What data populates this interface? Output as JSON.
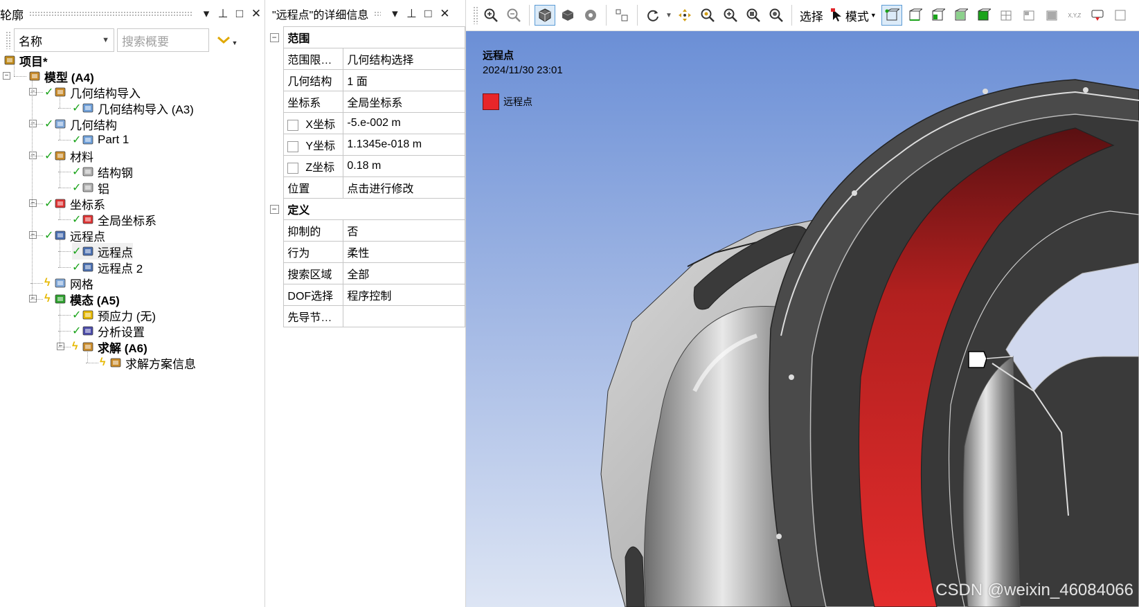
{
  "outline": {
    "title": "轮廓",
    "controls": [
      "▾",
      "⊥",
      "□",
      "✕"
    ],
    "name_select": "名称",
    "search_placeholder": "搜索概要",
    "tree": [
      {
        "label": "项目*",
        "bold": true,
        "status": "none",
        "icon": "project-icon"
      },
      {
        "label": "模型 (A4)",
        "bold": true,
        "status": "none",
        "icon": "model-icon"
      },
      {
        "label": "几何结构导入",
        "bold": false,
        "status": "check",
        "icon": "geometry-import-icon"
      },
      {
        "label": "几何结构导入 (A3)",
        "bold": false,
        "status": "check",
        "icon": "geometry-import-item-icon"
      },
      {
        "label": "几何结构",
        "bold": false,
        "status": "check",
        "icon": "geometry-icon"
      },
      {
        "label": "Part 1",
        "bold": false,
        "status": "check",
        "icon": "part-icon"
      },
      {
        "label": "材料",
        "bold": false,
        "status": "check",
        "icon": "materials-icon"
      },
      {
        "label": "结构钢",
        "bold": false,
        "status": "check",
        "icon": "material-tag-icon"
      },
      {
        "label": "铝",
        "bold": false,
        "status": "check",
        "icon": "material-tag-icon"
      },
      {
        "label": "坐标系",
        "bold": false,
        "status": "check",
        "icon": "coordinate-systems-icon"
      },
      {
        "label": "全局坐标系",
        "bold": false,
        "status": "check",
        "icon": "coordinate-system-icon"
      },
      {
        "label": "远程点",
        "bold": false,
        "status": "check",
        "icon": "remote-points-icon"
      },
      {
        "label": "远程点",
        "bold": false,
        "status": "check",
        "icon": "remote-point-icon"
      },
      {
        "label": "远程点 2",
        "bold": false,
        "status": "check",
        "icon": "remote-point-icon"
      },
      {
        "label": "网格",
        "bold": false,
        "status": "bolt",
        "icon": "mesh-icon"
      },
      {
        "label": "模态 (A5)",
        "bold": true,
        "status": "bolt",
        "icon": "modal-icon"
      },
      {
        "label": "预应力 (无)",
        "bold": false,
        "status": "check",
        "icon": "prestress-icon"
      },
      {
        "label": "分析设置",
        "bold": false,
        "status": "check",
        "icon": "analysis-settings-icon"
      },
      {
        "label": "求解 (A6)",
        "bold": true,
        "status": "bolt",
        "icon": "solution-icon"
      },
      {
        "label": "求解方案信息",
        "bold": false,
        "status": "bolt",
        "icon": "solution-info-icon"
      }
    ]
  },
  "details": {
    "title": "\"远程点\"的详细信息",
    "controls": [
      "▾",
      "⊥",
      "□",
      "✕"
    ],
    "groups": [
      {
        "name": "范围",
        "rows": [
          {
            "key": "范围限定...",
            "value": "几何结构选择",
            "checkbox": false
          },
          {
            "key": "几何结构",
            "value": "1 面",
            "checkbox": false
          },
          {
            "key": "坐标系",
            "value": "全局坐标系",
            "checkbox": false
          },
          {
            "key": "X坐标",
            "value": "-5.e-002 m",
            "checkbox": true
          },
          {
            "key": "Y坐标",
            "value": "1.1345e-018 m",
            "checkbox": true
          },
          {
            "key": "Z坐标",
            "value": "0.18 m",
            "checkbox": true
          },
          {
            "key": "位置",
            "value": "点击进行修改",
            "checkbox": false
          }
        ]
      },
      {
        "name": "定义",
        "rows": [
          {
            "key": "抑制的",
            "value": "否",
            "checkbox": false
          },
          {
            "key": "行为",
            "value": "柔性",
            "checkbox": false
          },
          {
            "key": "搜索区域",
            "value": "全部",
            "checkbox": false
          },
          {
            "key": "DOF选择",
            "value": "程序控制",
            "checkbox": false
          },
          {
            "key": "先导节点...",
            "value": "",
            "checkbox": false
          }
        ]
      }
    ]
  },
  "toolbar": {
    "select_label": "选择",
    "mode_label": "模式",
    "axes_label": "X,Y,Z"
  },
  "viewport": {
    "title": "远程点",
    "date": "2024/11/30 23:01",
    "legend_label": "远程点",
    "legend_color": "#e8262a",
    "watermark": "CSDN @weixin_46084066"
  }
}
